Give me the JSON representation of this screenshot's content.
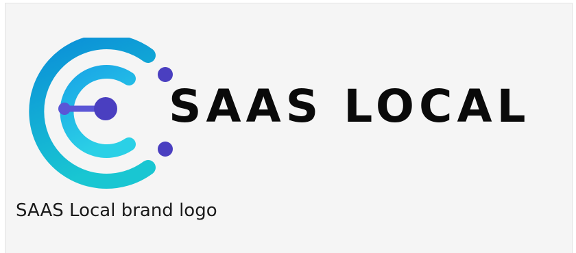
{
  "logo": {
    "wordmark": "SAAS LOCAL",
    "colors": {
      "outer_arc_start": "#0b8fd8",
      "outer_arc_end": "#19c6d2",
      "inner_arc_start": "#1aa6e6",
      "inner_arc_end": "#2bd0e6",
      "node": "#4a3fc0",
      "node_light": "#5b56d6",
      "wordmark": "#0a0a0a"
    }
  },
  "caption": {
    "text": "SAAS Local brand logo"
  }
}
